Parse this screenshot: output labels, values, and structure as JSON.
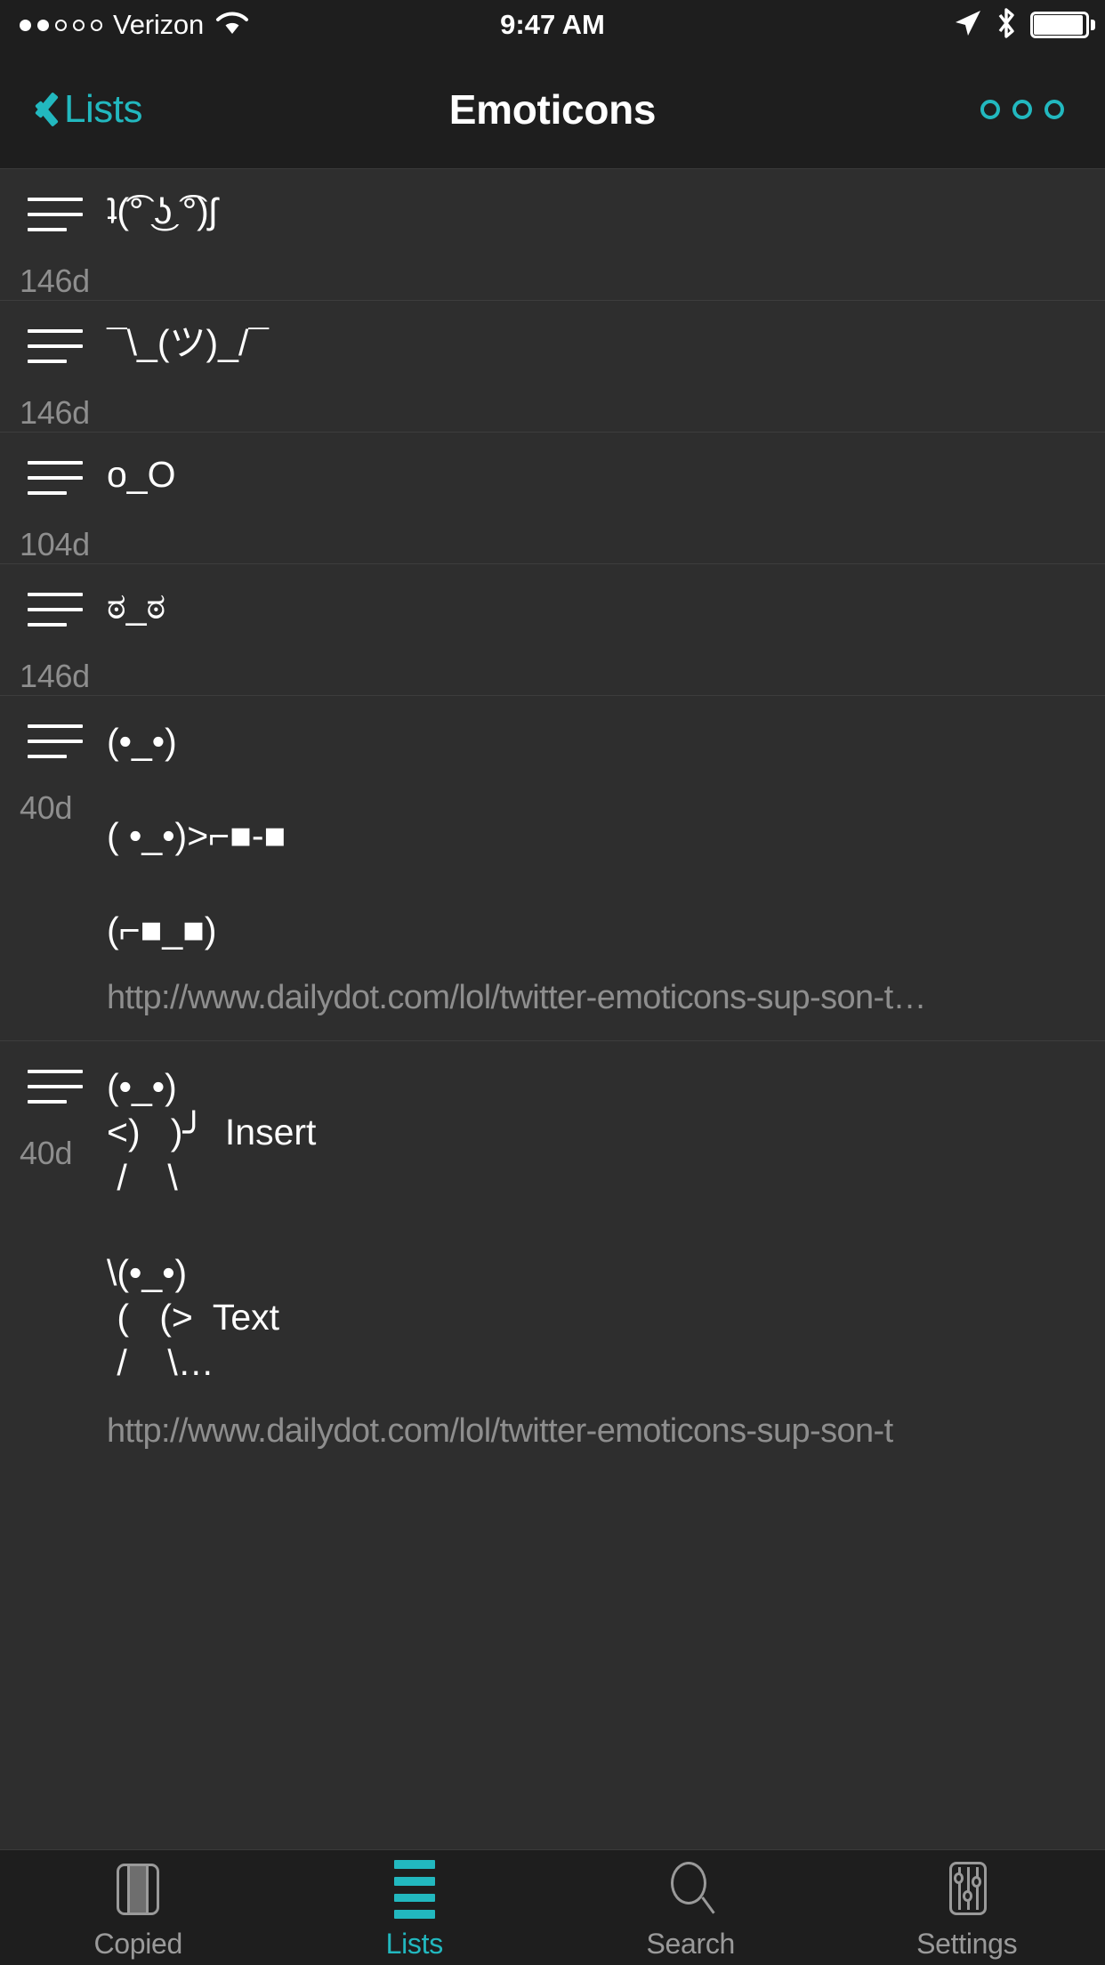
{
  "status_bar": {
    "carrier": "Verizon",
    "signal_dots_total": 5,
    "signal_dots_filled": 2,
    "time": "9:47 AM",
    "icons": [
      "location-arrow-icon",
      "bluetooth-icon",
      "battery-icon"
    ],
    "wifi_icon": "wifi-icon",
    "battery_full": true
  },
  "nav_bar": {
    "back_label": "Lists",
    "title": "Emoticons",
    "more_icon": "more-options-icon",
    "accent_color": "#22b8bf"
  },
  "list": {
    "rows": [
      {
        "age": "146d",
        "drag_handle_icon": "reorder-handle-icon",
        "lines": [
          "ʇ(͡° ͜ʖ ͡°)ʃ"
        ],
        "url": ""
      },
      {
        "age": "146d",
        "drag_handle_icon": "reorder-handle-icon",
        "lines": [
          "¯\\_(ツ)_/¯"
        ],
        "url": ""
      },
      {
        "age": "104d",
        "drag_handle_icon": "reorder-handle-icon",
        "lines": [
          "o_O"
        ],
        "url": ""
      },
      {
        "age": "146d",
        "drag_handle_icon": "reorder-handle-icon",
        "lines": [
          "ಠ_ಠ"
        ],
        "url": ""
      },
      {
        "age": "40d",
        "drag_handle_icon": "reorder-handle-icon",
        "lines": [
          "(•_•)",
          "( •_•)>⌐■-■",
          "(⌐■_■)"
        ],
        "url": "http://www.dailydot.com/lol/twitter-emoticons-sup-son-t…"
      },
      {
        "age": "40d",
        "drag_handle_icon": "reorder-handle-icon",
        "art_blocks": [
          "(•_•)\n<)   )╯  Insert\n /    \\",
          "\\(•_•)\n (   (>  Text\n /    \\…"
        ],
        "url": "http://www.dailydot.com/lol/twitter-emoticons-sup-son-t"
      }
    ]
  },
  "tab_bar": {
    "tabs": [
      {
        "label": "Copied",
        "icon": "clipboard-icon",
        "active": false
      },
      {
        "label": "Lists",
        "icon": "list-lines-icon",
        "active": true
      },
      {
        "label": "Search",
        "icon": "magnifier-icon",
        "active": false
      },
      {
        "label": "Settings",
        "icon": "sliders-icon",
        "active": false
      }
    ],
    "active_color": "#22b8bf",
    "inactive_color": "#9a9a9a"
  }
}
